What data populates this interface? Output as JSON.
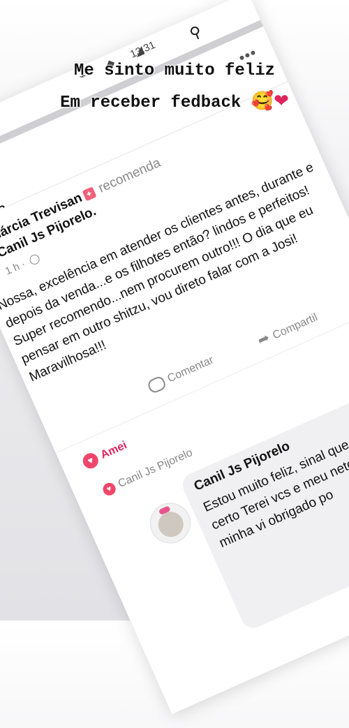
{
  "caption": {
    "line1": "Me sinto muito feliz",
    "line2": "Em receber fedback",
    "emojis": "🥰❤"
  },
  "status_bar": {
    "time": "13:31"
  },
  "profile": {
    "name": "cia Trevisan"
  },
  "review": {
    "author": "Márcia Trevisan",
    "action": "recomenda",
    "page": "Canil Js Pijorelo",
    "time": "1 h ·",
    "text": "Nossa, excelência em atender os clientes antes, durante e depois da venda...e os filhotes então? lindos e perfeitos! Super recomendo...nem procurem outro!!! O dia que eu pensar em outro shitzu, vou direto falar com a Josi! Maravilhosa!!!",
    "actions": {
      "comment": "Comentar",
      "share": "Compartil"
    },
    "reaction_label": "Amei",
    "reacted_by": "Canil Js Pijorelo"
  },
  "reply": {
    "author": "Canil Js Pijorelo",
    "text": "Estou muito feliz, sinal que fazendo tudo certo Terei vcs e meu neto li sempre em minha vi obrigado po"
  },
  "colors": {
    "accent": "#e0245e",
    "bubble": "#f0f0f2"
  }
}
